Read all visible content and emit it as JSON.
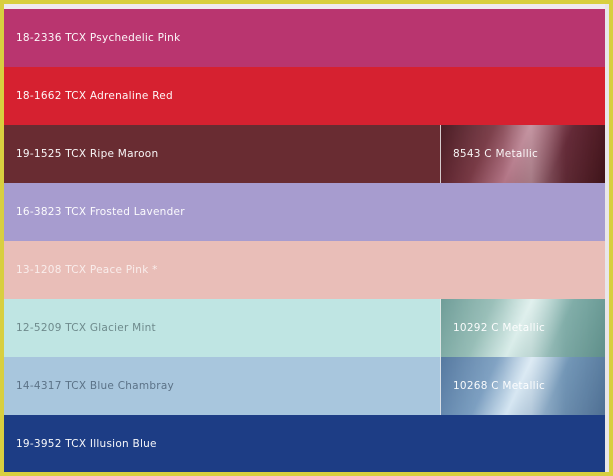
{
  "colors": {
    "frame": "#d8cf3f",
    "psychedelic_pink": "#b9356f",
    "adrenaline_red": "#d62130",
    "ripe_maroon": "#692c32",
    "frosted_lavender": "#a79ccf",
    "peace_pink": "#e9beb8",
    "glacier_mint": "#bfe5e3",
    "blue_chambray": "#a8c6dd",
    "illusion_blue": "#1d3d85"
  },
  "stripes": [
    {
      "label": "18-2336 TCX Psychedelic Pink"
    },
    {
      "label": "18-1662 TCX Adrenaline Red"
    },
    {
      "label": "19-1525 TCX Ripe Maroon",
      "metallic_label": "8543 C Metallic"
    },
    {
      "label": "16-3823 TCX Frosted Lavender"
    },
    {
      "label": "13-1208 TCX Peace Pink *"
    },
    {
      "label": "12-5209 TCX Glacier Mint",
      "metallic_label": "10292 C Metallic"
    },
    {
      "label": "14-4317 TCX Blue Chambray",
      "metallic_label": "10268 C Metallic"
    },
    {
      "label": "19-3952 TCX Illusion Blue"
    }
  ]
}
